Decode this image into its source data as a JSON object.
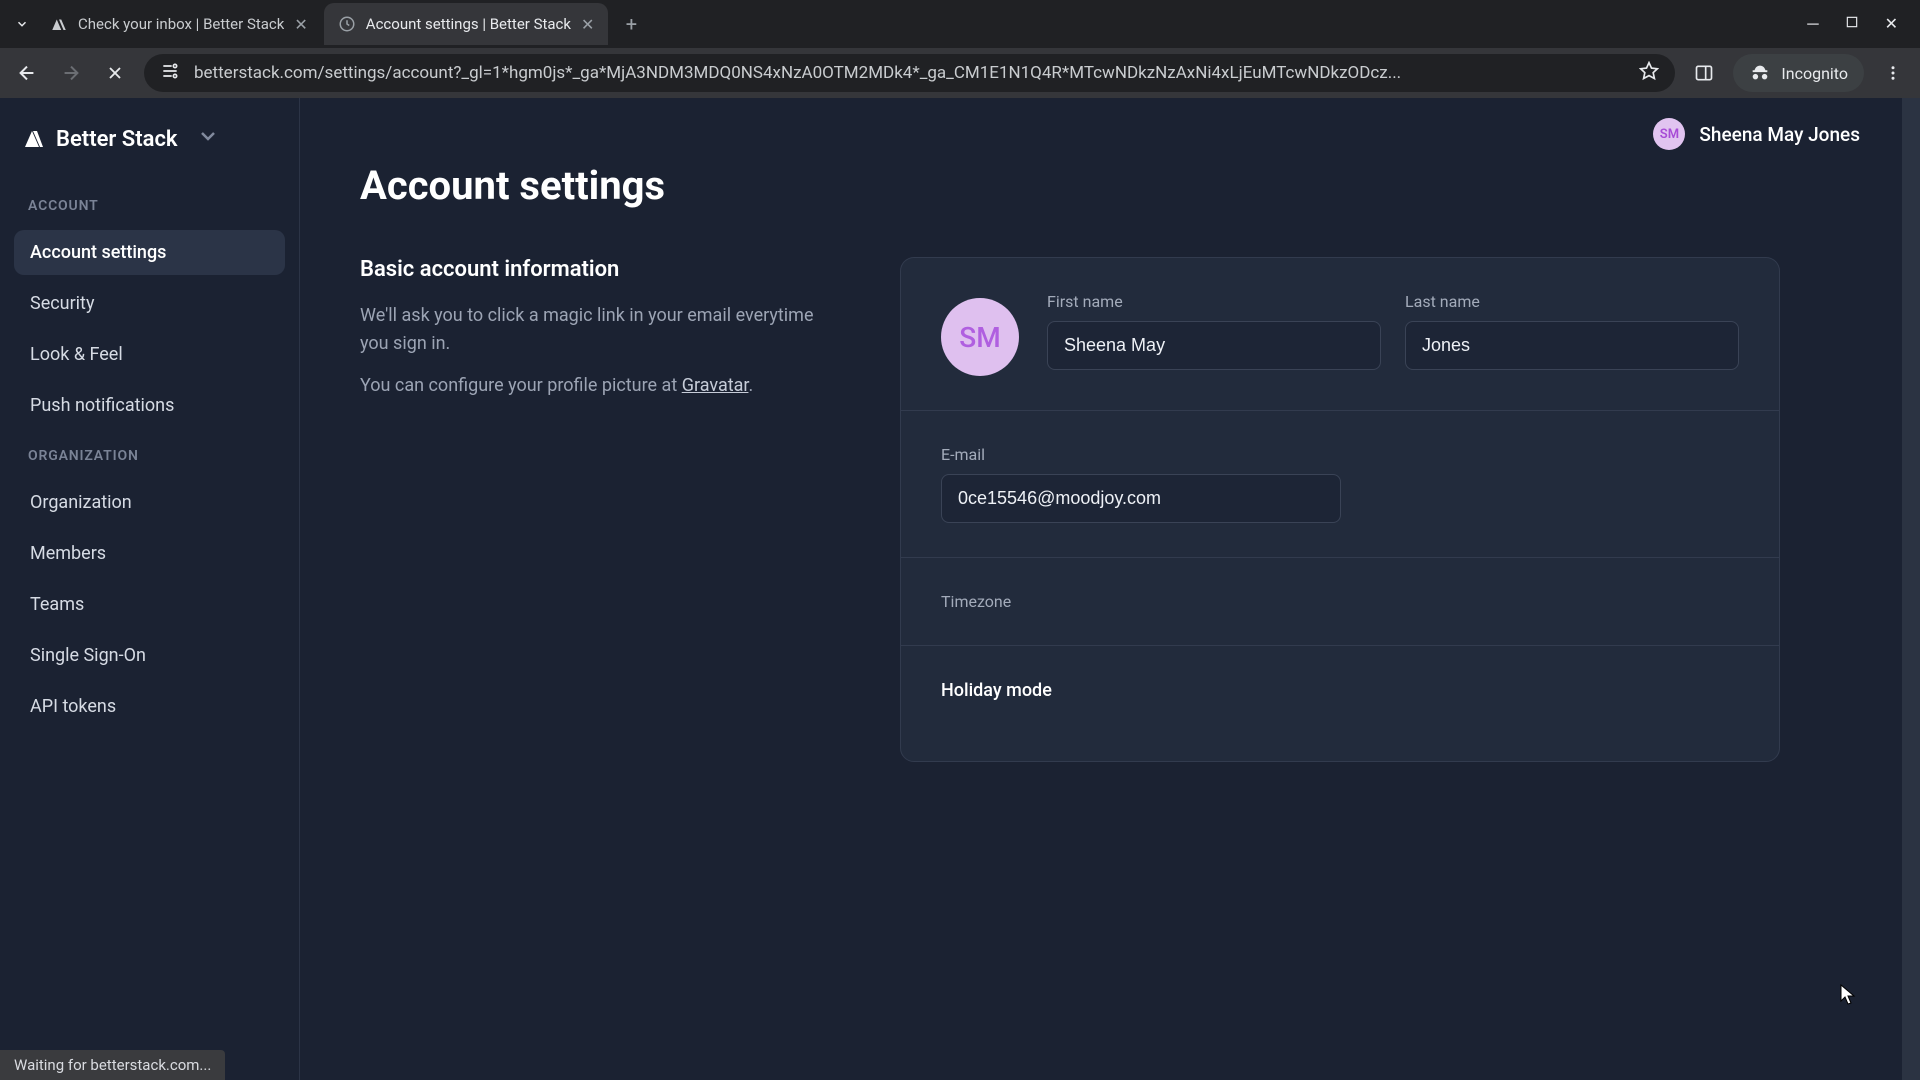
{
  "browser": {
    "tabs": [
      {
        "title": "Check your inbox | Better Stack",
        "active": false
      },
      {
        "title": "Account settings | Better Stack",
        "active": true
      }
    ],
    "url": "betterstack.com/settings/account?_gl=1*hgm0js*_ga*MjA3NDM3MDQ0NS4xNzA0OTM2MDk4*_ga_CM1E1N1Q4R*MTcwNDkzNzAxNi4xLjEuMTcwNDkzODcz...",
    "incognito_label": "Incognito",
    "status_text": "Waiting for betterstack.com..."
  },
  "brand": {
    "name": "Better Stack"
  },
  "user": {
    "full_name": "Sheena May Jones",
    "initials": "SM"
  },
  "sidebar": {
    "account_label": "ACCOUNT",
    "org_label": "ORGANIZATION",
    "account_items": [
      {
        "label": "Account settings"
      },
      {
        "label": "Security"
      },
      {
        "label": "Look & Feel"
      },
      {
        "label": "Push notifications"
      }
    ],
    "org_items": [
      {
        "label": "Organization"
      },
      {
        "label": "Members"
      },
      {
        "label": "Teams"
      },
      {
        "label": "Single Sign-On"
      },
      {
        "label": "API tokens"
      }
    ]
  },
  "page": {
    "title": "Account settings",
    "basic_info_title": "Basic account information",
    "basic_info_desc1": "We'll ask you to click a magic link in your email everytime you sign in.",
    "basic_info_desc2_prefix": "You can configure your profile picture at ",
    "basic_info_desc2_link": "Gravatar",
    "basic_info_desc2_suffix": "."
  },
  "form": {
    "first_name_label": "First name",
    "first_name_value": "Sheena May",
    "last_name_label": "Last name",
    "last_name_value": "Jones",
    "email_label": "E-mail",
    "email_value": "0ce15546@moodjoy.com",
    "timezone_label": "Timezone",
    "holiday_label": "Holiday mode"
  }
}
